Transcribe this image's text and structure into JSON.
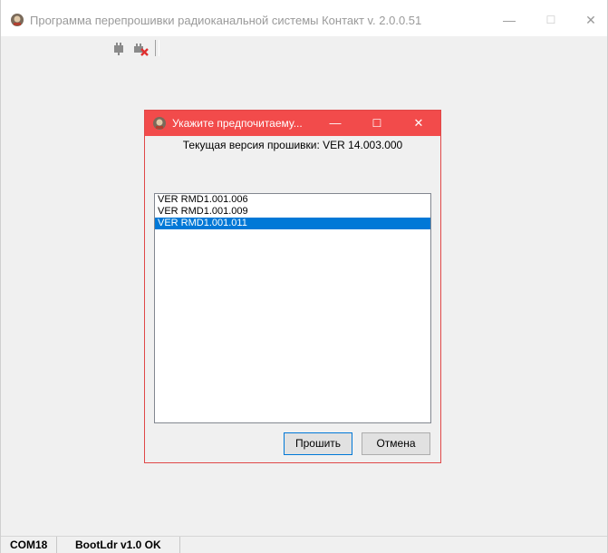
{
  "window": {
    "title": "Программа перепрошивки радиоканальной системы Контакт v. 2.0.0.51",
    "minimize": "—",
    "maximize": "☐",
    "close": "✕"
  },
  "toolbar": {
    "icons": [
      "connect-icon",
      "disconnect-icon"
    ]
  },
  "dialog": {
    "title": "Укажите предпочитаему...",
    "minimize": "—",
    "maximize": "☐",
    "close": "✕",
    "caption": "Текущая версия прошивки: VER 14.003.000",
    "items": [
      "VER RMD1.001.006",
      "VER RMD1.001.009",
      "VER RMD1.001.011"
    ],
    "selected_index": 2,
    "ok_label": "Прошить",
    "cancel_label": "Отмена"
  },
  "statusbar": {
    "port": "COM18",
    "bootloader": "BootLdr v1.0 OK"
  },
  "colors": {
    "dialog_title_bg": "#f24b4b",
    "selection": "#0078d7"
  }
}
